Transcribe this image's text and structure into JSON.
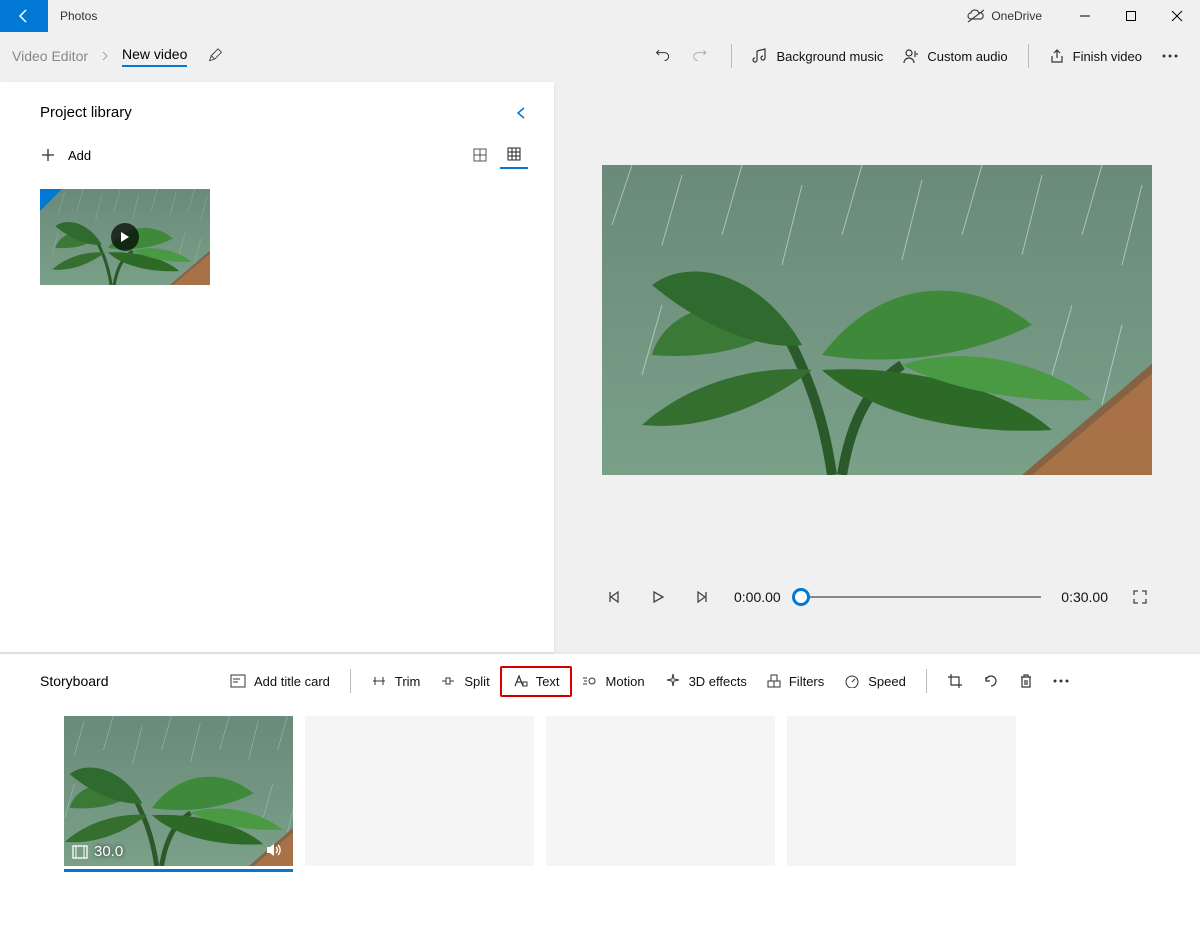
{
  "titlebar": {
    "app_name": "Photos",
    "onedrive_label": "OneDrive"
  },
  "header": {
    "breadcrumb_parent": "Video Editor",
    "breadcrumb_current": "New video",
    "tool_bg_music": "Background music",
    "tool_custom_audio": "Custom audio",
    "tool_finish": "Finish video"
  },
  "library": {
    "title": "Project library",
    "add_label": "Add"
  },
  "preview": {
    "time_current": "0:00.00",
    "time_total": "0:30.00"
  },
  "storyboard": {
    "title": "Storyboard",
    "add_title_card": "Add title card",
    "trim": "Trim",
    "split": "Split",
    "text": "Text",
    "motion": "Motion",
    "effects3d": "3D effects",
    "filters": "Filters",
    "speed": "Speed",
    "clip_duration": "30.0"
  }
}
